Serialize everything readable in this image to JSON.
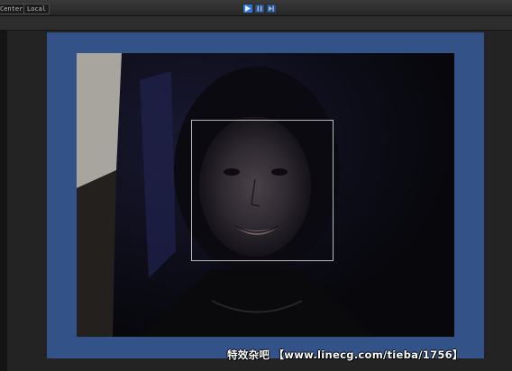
{
  "toolbar": {
    "gizmo_label": "Center",
    "space_label": "Local",
    "play_icon": "play-icon",
    "pause_icon": "pause-icon",
    "step_icon": "step-icon",
    "accent_color": "#2f74d6"
  },
  "viewport": {
    "background_color": "#335287",
    "face_detection_box_color": "#b9b9b9"
  },
  "watermark": {
    "text": "特效杂吧 【www.linecg.com/tieba/1756】"
  }
}
